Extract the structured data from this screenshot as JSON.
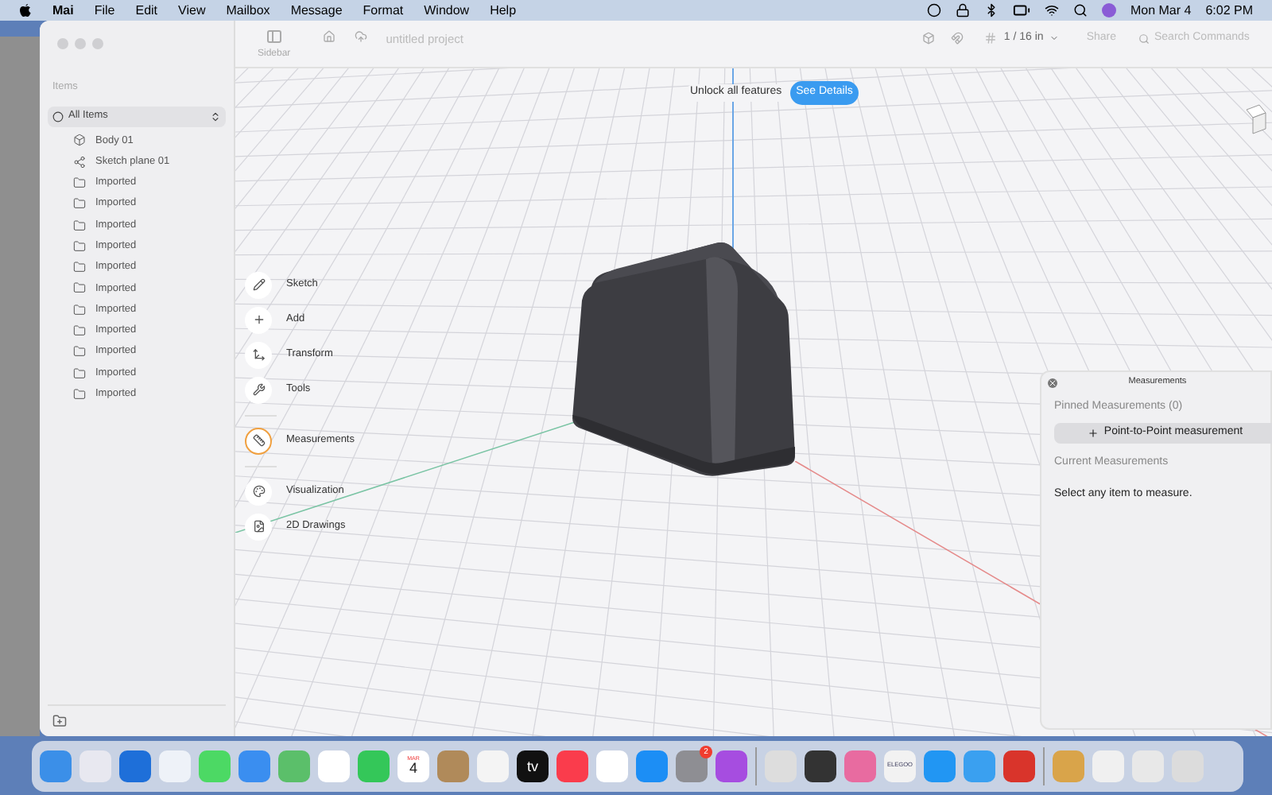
{
  "menu_bar": {
    "app": "Mai",
    "menus": [
      "File",
      "Edit",
      "View",
      "Mailbox",
      "Message",
      "Format",
      "Window",
      "Help"
    ],
    "date": "Mon Mar 4",
    "time": "6:02 PM"
  },
  "toolbar": {
    "sidebar_label": "Sidebar",
    "project": "untitled project",
    "units": "1 / 16 in",
    "share": "Share",
    "search": {
      "placeholder": "Search Commands"
    }
  },
  "sidebar": {
    "heading": "Items",
    "filter": "All Items",
    "items": [
      {
        "kind": "body",
        "label": "Body 01"
      },
      {
        "kind": "sketch",
        "label": "Sketch plane 01"
      },
      {
        "kind": "folder",
        "label": "Imported"
      },
      {
        "kind": "folder",
        "label": "Imported"
      },
      {
        "kind": "folder",
        "label": "Imported"
      },
      {
        "kind": "folder",
        "label": "Imported"
      },
      {
        "kind": "folder",
        "label": "Imported"
      },
      {
        "kind": "folder",
        "label": "Imported"
      },
      {
        "kind": "folder",
        "label": "Imported"
      },
      {
        "kind": "folder",
        "label": "Imported"
      },
      {
        "kind": "folder",
        "label": "Imported"
      },
      {
        "kind": "folder",
        "label": "Imported"
      },
      {
        "kind": "folder",
        "label": "Imported"
      }
    ]
  },
  "banner": {
    "text": "Unlock all features",
    "button": "See Details"
  },
  "tool_groups": [
    [
      {
        "kind": "sketch",
        "label": "Sketch",
        "selected": false
      },
      {
        "kind": "add",
        "label": "Add",
        "selected": false
      },
      {
        "kind": "transform",
        "label": "Transform",
        "selected": false
      },
      {
        "kind": "tools",
        "label": "Tools",
        "selected": false
      }
    ],
    [
      {
        "kind": "measure",
        "label": "Measurements",
        "selected": true
      }
    ],
    [
      {
        "kind": "visual",
        "label": "Visualization",
        "selected": false
      },
      {
        "kind": "drawing",
        "label": "2D Drawings",
        "selected": false
      }
    ]
  ],
  "measurements": {
    "title": "Measurements",
    "pinned": "Pinned Measurements (0)",
    "button": "Point-to-Point measurement",
    "current": "Current Measurements",
    "hint": "Select any item to measure."
  },
  "dock": [
    [
      {
        "color": "#3b8fe8"
      },
      {
        "color": "#e8e8f0"
      },
      {
        "color": "#1e6fd9"
      },
      {
        "color": "#eef2f8"
      },
      {
        "color": "#4cd964"
      },
      {
        "color": "#3a8ef0"
      },
      {
        "color": "#5bbf6a"
      },
      {
        "color": "#ffffff"
      },
      {
        "color": "#34c759"
      },
      {
        "color": "#ffffff",
        "caption": "MAR",
        "label": "4"
      },
      {
        "color": "#b08a5a"
      },
      {
        "color": "#f4f4f4"
      },
      {
        "color": "#111111",
        "label": "tv"
      },
      {
        "color": "#fa3c4c"
      },
      {
        "color": "#ffffff"
      },
      {
        "color": "#1c8ef5"
      },
      {
        "color": "#8e8e93",
        "badge": "2"
      },
      {
        "color": "#a64de0"
      }
    ],
    [
      {
        "color": "#dddddd"
      },
      {
        "color": "#333333"
      },
      {
        "color": "#e86ba0"
      },
      {
        "color": "#f2f2f2",
        "label": "ELEGOO"
      },
      {
        "color": "#2196f3"
      },
      {
        "color": "#3aa0f0"
      },
      {
        "color": "#d9342b"
      }
    ],
    [
      {
        "color": "#d9a44a"
      },
      {
        "color": "#f0f0f0"
      },
      {
        "color": "#e8e8e8"
      },
      {
        "color": "#dcdcdc"
      }
    ]
  ]
}
